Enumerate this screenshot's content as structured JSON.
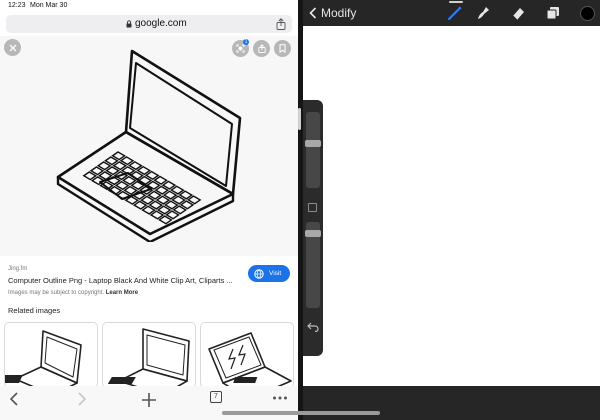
{
  "status_bar": {
    "time": "12:23",
    "date": "Mon Mar 30"
  },
  "safari": {
    "url_domain": "google.com",
    "lens_badge": "1",
    "source_site": "Jing.fm",
    "image_title": "Computer Outline Png - Laptop Black And White Clip Art, Cliparts ...",
    "visit_label": "Visit",
    "copyright_text": "Images may be subject to copyright.",
    "learn_more_label": "Learn More",
    "related_heading": "Related images",
    "tab_count": "7"
  },
  "procreate": {
    "back_label": "Modify",
    "accent_color": "#1a73e8",
    "current_color": "#000000",
    "tools": [
      "brush-icon",
      "smudge-icon",
      "eraser-icon",
      "layers-icon"
    ]
  }
}
